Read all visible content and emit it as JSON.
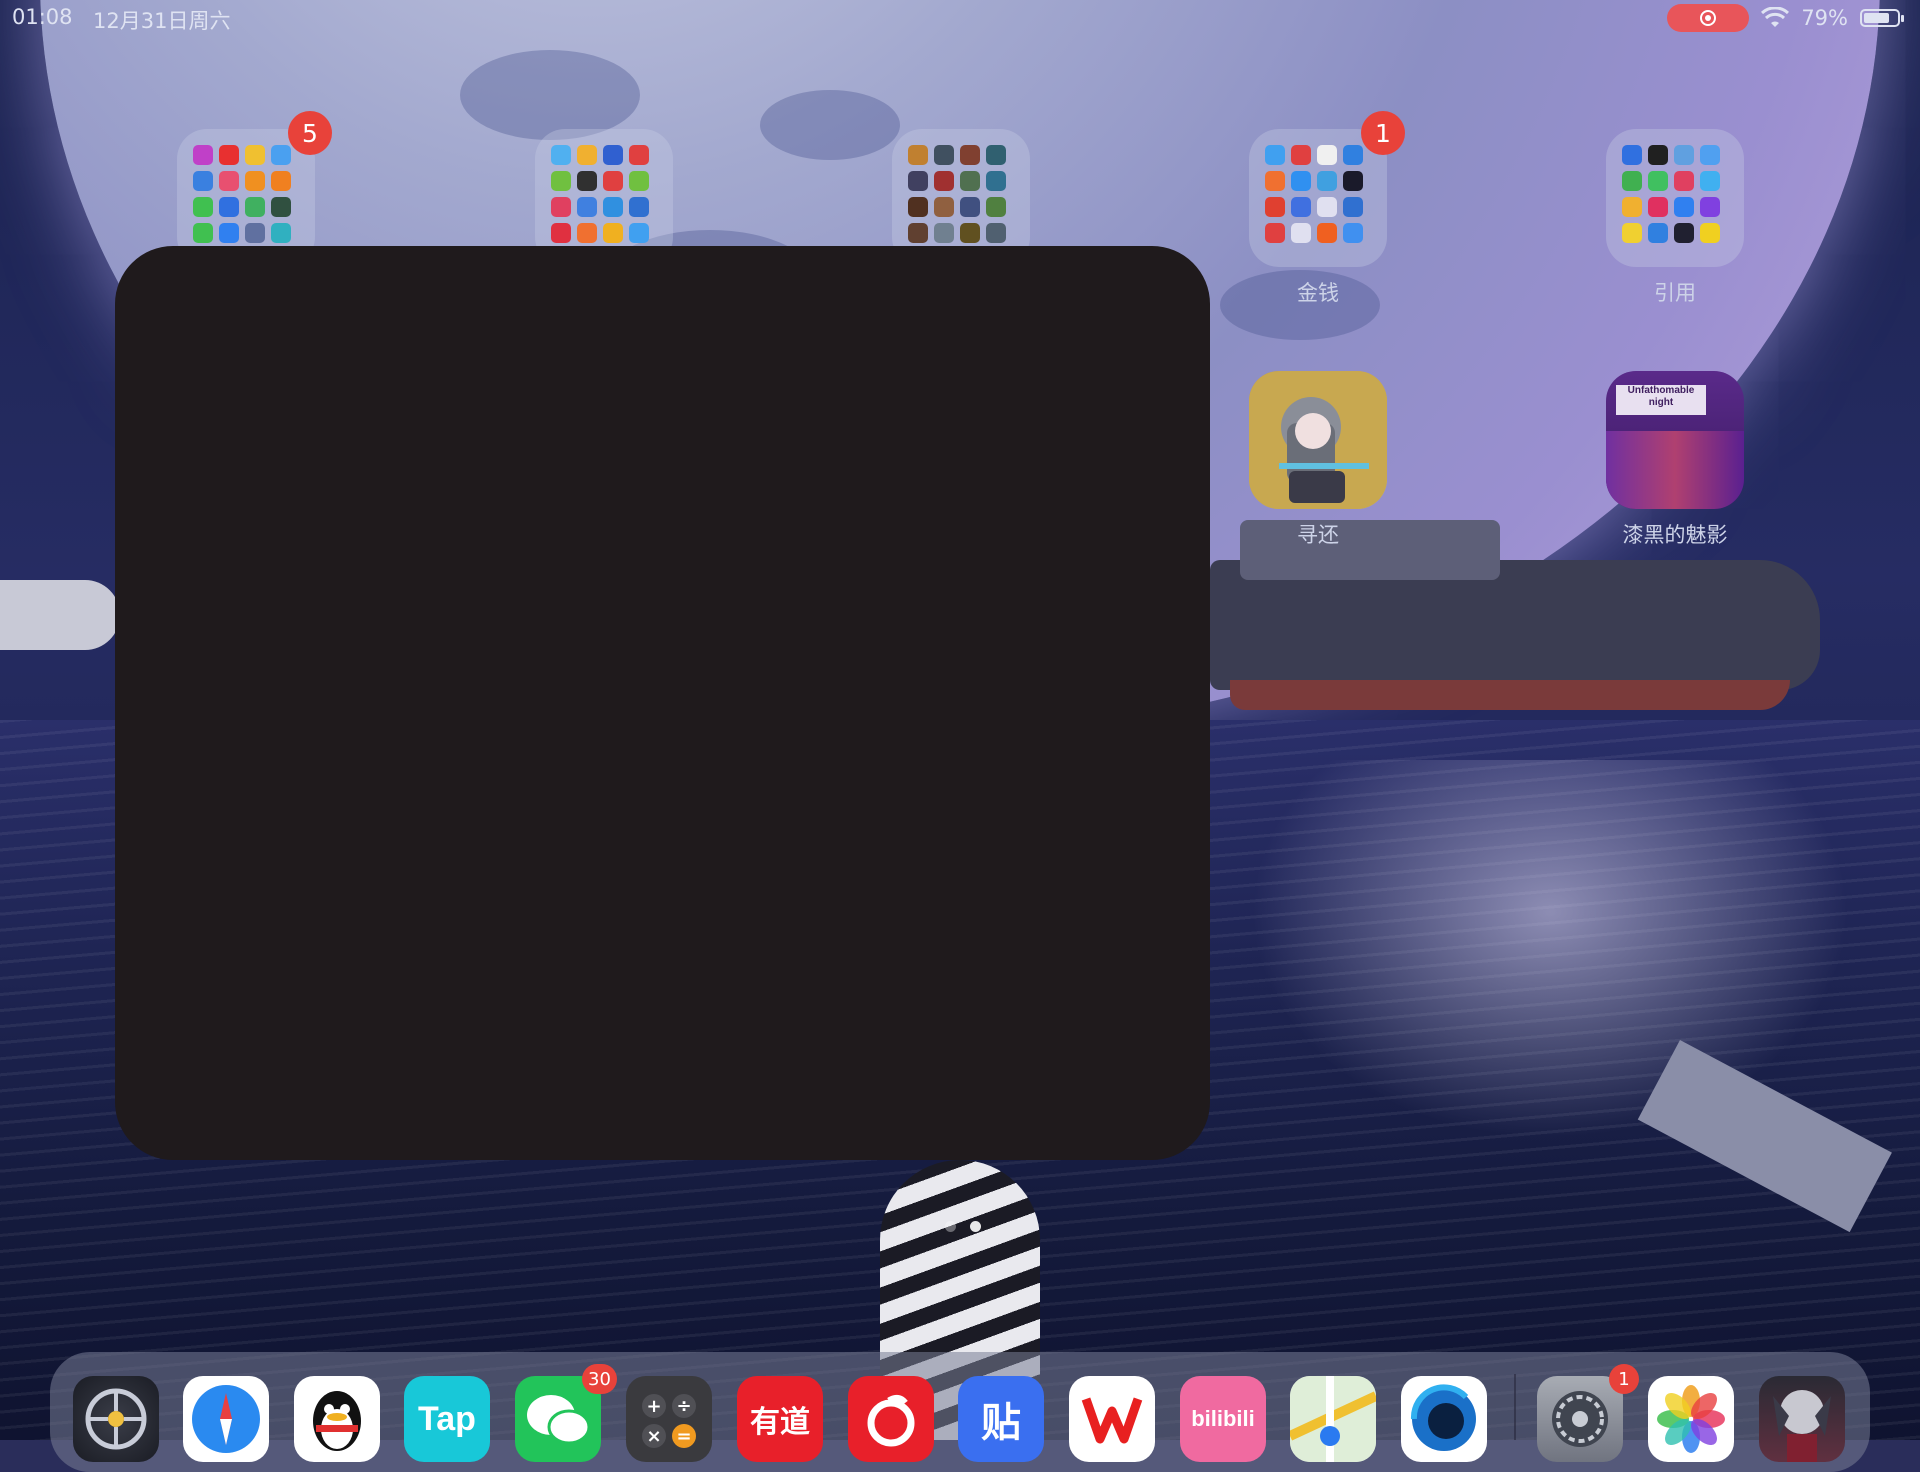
{
  "status_bar": {
    "time": "01:08",
    "date": "12月31日周六",
    "wifi": "wifi-icon",
    "battery_percent_text": "79%",
    "battery_level": 0.79,
    "screen_recording": true
  },
  "folders": [
    {
      "label": "",
      "badge": "5"
    },
    {
      "label": "",
      "badge": ""
    },
    {
      "label": "",
      "badge": ""
    },
    {
      "label": "金钱",
      "badge": "1"
    },
    {
      "label": "引用",
      "badge": ""
    }
  ],
  "apps": [
    {
      "label": "寻还"
    },
    {
      "label": "漆黑的魅影",
      "icon_text": "Unfathomable night"
    }
  ],
  "page_indicator": {
    "pages": 2,
    "current": 2
  },
  "dock": {
    "apps": [
      {
        "name": "game-center-icon",
        "text": ""
      },
      {
        "name": "safari-icon",
        "text": ""
      },
      {
        "name": "qq-icon",
        "text": ""
      },
      {
        "name": "taptap-icon",
        "text": "Tap"
      },
      {
        "name": "wechat-icon",
        "text": "",
        "badge": "30"
      },
      {
        "name": "calculator-icon",
        "text": ""
      },
      {
        "name": "youdao-icon",
        "text": "有道"
      },
      {
        "name": "netease-music-icon",
        "text": ""
      },
      {
        "name": "tieba-icon",
        "text": "贴"
      },
      {
        "name": "wps-icon",
        "text": ""
      },
      {
        "name": "bilibili-icon",
        "text": "bilibili"
      },
      {
        "name": "maps-icon",
        "text": ""
      },
      {
        "name": "browser-icon",
        "text": ""
      },
      {
        "name": "settings-icon",
        "text": "",
        "badge": "1"
      },
      {
        "name": "photos-icon",
        "text": ""
      },
      {
        "name": "game-icon",
        "text": ""
      }
    ]
  }
}
